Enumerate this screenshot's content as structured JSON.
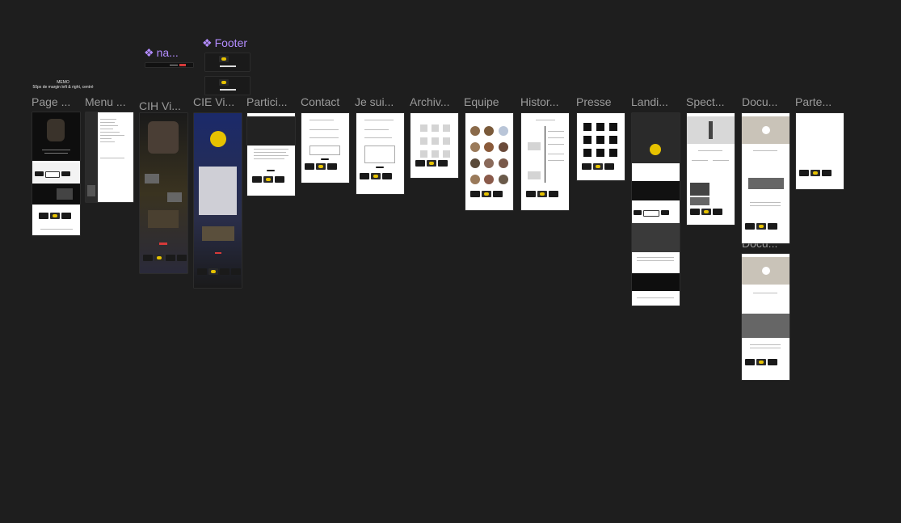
{
  "canvas": {
    "background": "#1e1e1e"
  },
  "memo": {
    "title": "MEMO",
    "text": "50px de margin left & right, centré"
  },
  "components": [
    {
      "id": "na",
      "label": "na..."
    },
    {
      "id": "footer",
      "label": "Footer"
    }
  ],
  "frames": [
    {
      "id": "page",
      "label": "Page ..."
    },
    {
      "id": "menu",
      "label": "Menu ..."
    },
    {
      "id": "cih",
      "label": "CIH Vi..."
    },
    {
      "id": "cie",
      "label": "CIE Vi..."
    },
    {
      "id": "partici",
      "label": "Partici..."
    },
    {
      "id": "contact",
      "label": "Contact"
    },
    {
      "id": "jesui",
      "label": "Je sui..."
    },
    {
      "id": "archiv",
      "label": "Archiv..."
    },
    {
      "id": "equipe",
      "label": "Equipe"
    },
    {
      "id": "histor",
      "label": "Histor..."
    },
    {
      "id": "presse",
      "label": "Presse"
    },
    {
      "id": "landi",
      "label": "Landi..."
    },
    {
      "id": "spect",
      "label": "Spect..."
    },
    {
      "id": "docu",
      "label": "Docu..."
    },
    {
      "id": "parte",
      "label": "Parte..."
    }
  ],
  "second_docu_label": "Docu...",
  "colors": {
    "label": "#9b9b9b",
    "component": "#b38cff",
    "accent_yellow": "#e6c200",
    "accent_red": "#d63a3a"
  }
}
